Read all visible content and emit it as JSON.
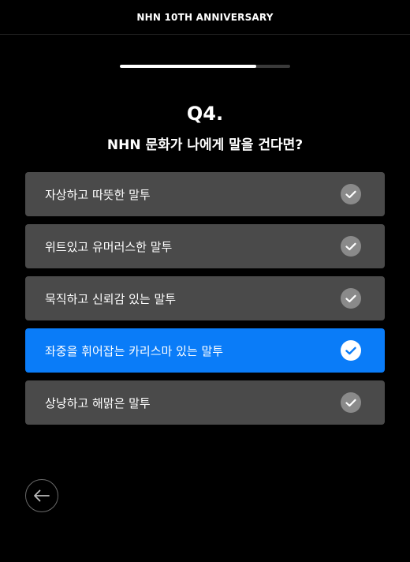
{
  "header": {
    "title": "NHN 10TH ANNIVERSARY"
  },
  "progress": {
    "value": 0.8
  },
  "question": {
    "number": "Q4.",
    "text": "NHN 문화가 나에게 말을 건다면?"
  },
  "options": [
    {
      "label": "자상하고 따뜻한 말투",
      "selected": false
    },
    {
      "label": "위트있고 유머러스한 말투",
      "selected": false
    },
    {
      "label": "묵직하고 신뢰감 있는 말투",
      "selected": false
    },
    {
      "label": "좌중을 휘어잡는 카리스마 있는 말투",
      "selected": true
    },
    {
      "label": "상냥하고 해맑은 말투",
      "selected": false
    }
  ],
  "icons": {
    "check": "check-icon",
    "back": "arrow-left-icon"
  },
  "colors": {
    "background": "#000000",
    "option_default": "#4a4a4a",
    "option_selected": "#0a7cf8",
    "check_default": "#8a8a8a"
  }
}
